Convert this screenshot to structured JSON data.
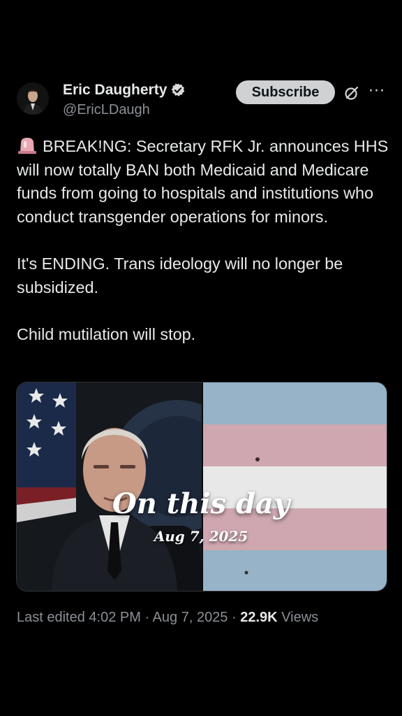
{
  "author": {
    "name": "Eric Daugherty",
    "handle": "@EricLDaugh",
    "verified_color": "#d9dadc"
  },
  "actions": {
    "subscribe_label": "Subscribe",
    "grok_icon": "grok-icon",
    "more_label": "···"
  },
  "post": {
    "para1": "BREAK!NG: Secretary RFK Jr. announces HHS will now totally BAN both Medicaid and Medicare funds from going to hospitals and institutions who conduct transgender operations for minors.",
    "para2": "It's ENDING. Trans ideology will no longer be subsidized.",
    "para3": "Child mutilation will stop.",
    "emoji": "siren-icon"
  },
  "media": {
    "overlay_title": "On this day",
    "overlay_date": "Aug 7, 2025",
    "flag_colors": [
      "#96b3c8",
      "#cfa7b0",
      "#e8e8e8"
    ]
  },
  "meta": {
    "prefix": "Last edited 4:02 PM · Aug 7, 2025 · ",
    "views_count": "22.9K",
    "views_label": " Views"
  }
}
